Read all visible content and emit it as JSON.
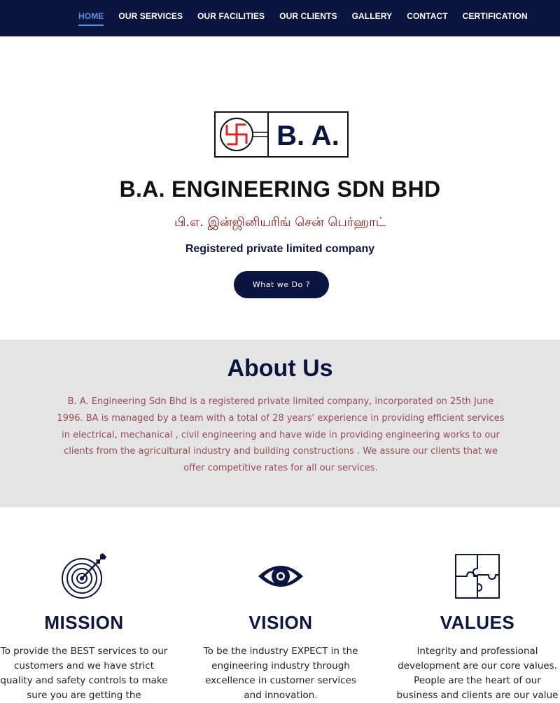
{
  "nav": {
    "items": [
      {
        "label": "HOME",
        "active": true
      },
      {
        "label": "OUR SERVICES"
      },
      {
        "label": "OUR FACILITIES"
      },
      {
        "label": "OUR CLIENTS"
      },
      {
        "label": "GALLERY"
      },
      {
        "label": "CONTACT"
      },
      {
        "label": "CERTIFICATION"
      }
    ]
  },
  "hero": {
    "logo_text": "B. A.",
    "company_name": "B.A. ENGINEERING SDN BHD",
    "tamil_name": "பி.எ. இன்ஜினியரிங் சென் பெர்ஹாட்",
    "company_type": "Registered private limited company",
    "cta_label": "What we Do ?"
  },
  "about": {
    "title": "About Us",
    "text": "B. A. Engineering Sdn Bhd is a registered private limited company, incorporated on 25th June 1996. BA is managed by a team with a total of 28 years' experience in providing efficient services in electrical, mechanical , civil engineering and have wide in providing engineering works to our clients from the agricultural industry and building constructions . We assure our clients that we offer competitive rates for all our services."
  },
  "pillars": {
    "mission": {
      "icon": "target-icon",
      "title": "MISSION",
      "text": "To provide the BEST services to our customers and we have strict quality and safety controls to make sure you are getting the"
    },
    "vision": {
      "icon": "eye-icon",
      "title": "VISION",
      "text": "To be the industry EXPECT in the engineering industry through excellence in customer services and innovation."
    },
    "values": {
      "icon": "puzzle-icon",
      "title": "VALUES",
      "text": "Integrity and professional development are our core values. People are the heart of our business and clients are our value"
    }
  },
  "colors": {
    "navy": "#0b1540",
    "active_link": "#5b8fe0",
    "logo_red": "#e02020",
    "tamil_red": "#8b1010",
    "about_bg": "#e4e4e4",
    "about_text": "#9b4b55"
  }
}
